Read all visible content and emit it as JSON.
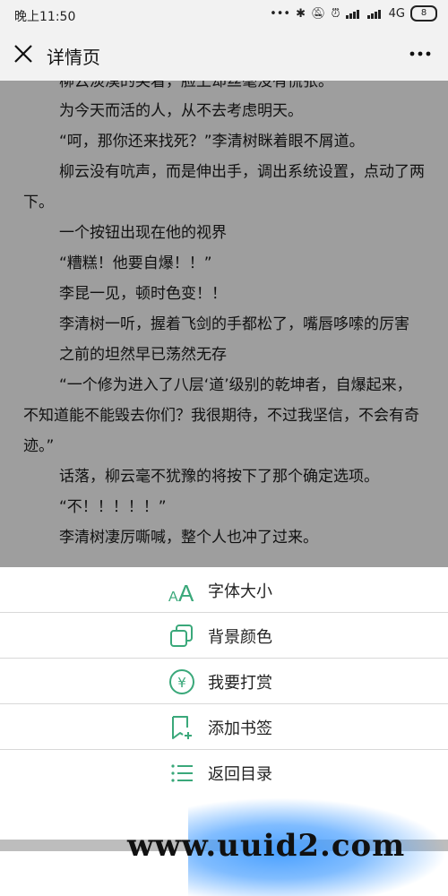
{
  "status_bar": {
    "time": "晚上11:50",
    "network": "4G",
    "battery": "8"
  },
  "header": {
    "title": "详情页"
  },
  "reader": {
    "partial_top": "柳云淡漠的笑着，脸上却丝毫没有慌张。",
    "paragraphs": [
      "为今天而活的人，从不去考虑明天。",
      "“呵，那你还来找死？”李清树眯着眼不屑道。",
      "柳云没有吭声，而是伸出手，调出系统设置，点动了两下。",
      "一个按钮出现在他的视界",
      "“糟糕！他要自爆！！”",
      "李昆一见，顿时色变！！",
      "李清树一听，握着飞剑的手都松了，嘴唇哆嗦的厉害",
      "之前的坦然早已荡然无存",
      "“一个修为进入了八层‘道’级别的乾坤者，自爆起来，不知道能不能毁去你们？我很期待，不过我坚信，不会有奇迹。”",
      "话落，柳云毫不犹豫的将按下了那个确定选项。",
      "“不！！！！！”",
      "李清树凄厉嘶喊，整个人也冲了过来。"
    ]
  },
  "menu": {
    "items": [
      {
        "label": "字体大小",
        "icon": "font-size-icon"
      },
      {
        "label": "背景颜色",
        "icon": "background-color-icon"
      },
      {
        "label": "我要打赏",
        "icon": "yen-coin-icon"
      },
      {
        "label": "添加书签",
        "icon": "bookmark-add-icon"
      },
      {
        "label": "返回目录",
        "icon": "list-icon"
      }
    ]
  },
  "watermark": "www.uuid2.com",
  "colors": {
    "accent": "#3aa87a",
    "overlay": "#9e9e9e",
    "sheet": "#ffffff"
  }
}
